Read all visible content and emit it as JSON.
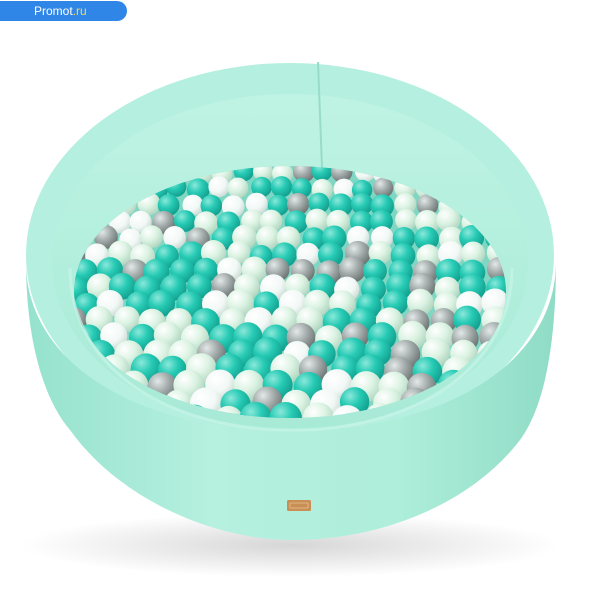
{
  "watermark": {
    "name": "Promot",
    "tld": ".ru"
  },
  "colors": {
    "pool_side": "#a9ecd9",
    "pool_inner": "#b8f0e1",
    "background": "#ffffff",
    "ball_turquoise": "#27cbb5",
    "ball_mint": "#d8f3e2",
    "ball_white": "#f4fbf8",
    "ball_silver": "#9ea7a6",
    "label_tag": "#c98f55",
    "badge_blue": "#2f86e6"
  },
  "scene": {
    "subject": "round-foam-ball-pit",
    "ball_colors": [
      "turquoise",
      "mint",
      "white",
      "silver"
    ]
  }
}
